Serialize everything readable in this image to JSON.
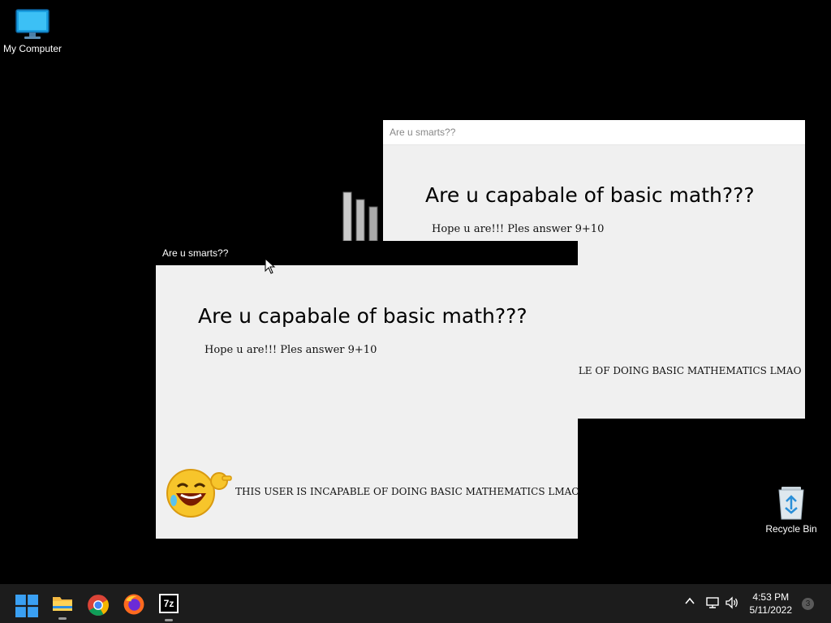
{
  "desktop": {
    "icons": [
      {
        "label": "My Computer"
      },
      {
        "label": "Recycle Bin"
      }
    ]
  },
  "windows": [
    {
      "title": "Are u smarts??",
      "heading": "Are u capabale of basic math???",
      "prompt": "Hope u are!!! Ples answer 9+10",
      "verdict": "BLE OF DOING BASIC MATHEMATICS LMAO"
    },
    {
      "title": "Are u smarts??",
      "heading": "Are u capabale of basic math???",
      "prompt": "Hope u are!!! Ples answer 9+10",
      "verdict": "THIS USER IS INCAPABLE OF DOING BASIC MATHEMATICS LMAO"
    }
  ],
  "taskbar": {
    "apps": [
      {
        "icon": "windows-start-icon"
      },
      {
        "icon": "file-explorer-icon",
        "running": true
      },
      {
        "icon": "chrome-icon"
      },
      {
        "icon": "firefox-icon"
      },
      {
        "icon": "7zip-icon",
        "label": "7z",
        "running": true
      }
    ],
    "tray": {
      "icons": [
        "chevron-up-icon",
        "network-icon",
        "volume-icon"
      ],
      "time": "4:53 PM",
      "date": "5/11/2022",
      "notification_count": "3"
    }
  },
  "colors": {
    "desktop_bg": "#000000",
    "window_bg": "#f0f0f0",
    "taskbar_bg": "#1c1c1c",
    "windows_blue": "#0078d4"
  }
}
